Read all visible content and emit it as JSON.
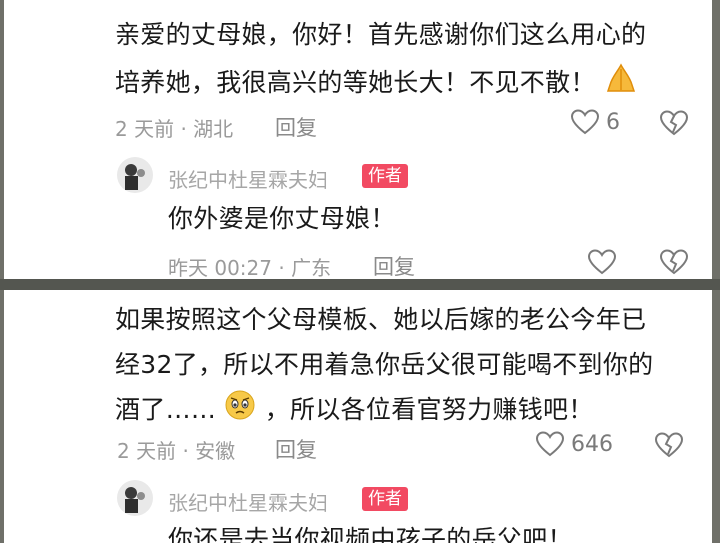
{
  "comment1": {
    "text_line1": "亲爱的丈母娘，你好！首先感谢你们这么用心的",
    "text_line2": "培养她，我很高兴的等她长大！不见不散！",
    "emoji": "pray-emoji",
    "meta": "2 天前 · 湖北",
    "reply_label": "回复",
    "likes": "6",
    "reply": {
      "author": "张纪中杜星霖夫妇",
      "badge": "作者",
      "text": "你外婆是你丈母娘！",
      "meta": "昨天 00:27 · 广东",
      "reply_label": "回复"
    }
  },
  "comment2": {
    "text_line1": "如果按照这个父母模板、她以后嫁的老公今年已",
    "text_line2": "经32了，所以不用着急你岳父很可能喝不到你的",
    "text_line3_a": "酒了……",
    "text_line3_b": "，所以各位看官努力赚钱吧！",
    "emoji": "worried-face-emoji",
    "meta": "2 天前 · 安徽",
    "reply_label": "回复",
    "likes": "646",
    "reply": {
      "author": "张纪中杜星霖夫妇",
      "badge": "作者",
      "text": "你还是去当你视频中孩子的岳父吧！"
    }
  },
  "colors": {
    "badge": "#f24a62",
    "meta": "#9a9a9a",
    "background": "#6f7069"
  }
}
